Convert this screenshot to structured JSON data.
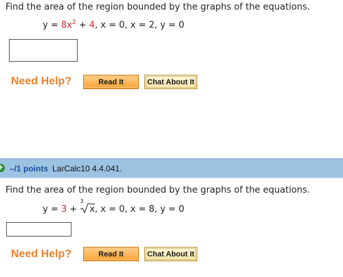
{
  "q1": {
    "prompt": "Find the area of the region bounded by the graphs of the equations.",
    "eq_y": "y = ",
    "eq_term1": "8x",
    "eq_exp": "2",
    "eq_plus": " + ",
    "eq_term2": "4",
    "eq_rest": ",  x = 0,  x = 2,  y = 0",
    "answer_value": ""
  },
  "help": {
    "label": "Need Help?",
    "read_it": "Read It",
    "chat_about_it": "Chat About It"
  },
  "q2": {
    "points": "–/1 points",
    "id": "LarCalc10 4.4.041.",
    "prompt": "Find the area of the region bounded by the graphs of the equations.",
    "eq_y": "y = ",
    "eq_term1": "3",
    "eq_plus": " + ",
    "root_index": "3",
    "root_radicand": "x",
    "eq_rest": ",    x = 0,    x = 8,    y = 0",
    "answer_value": ""
  },
  "colors": {
    "coefficient_red": "#cc2a2a",
    "need_help_orange": "#e98230",
    "header_blue": "#9dc3e3",
    "points_blue": "#1c4f9c"
  },
  "icons": {
    "expand": "plus-circle-icon"
  }
}
